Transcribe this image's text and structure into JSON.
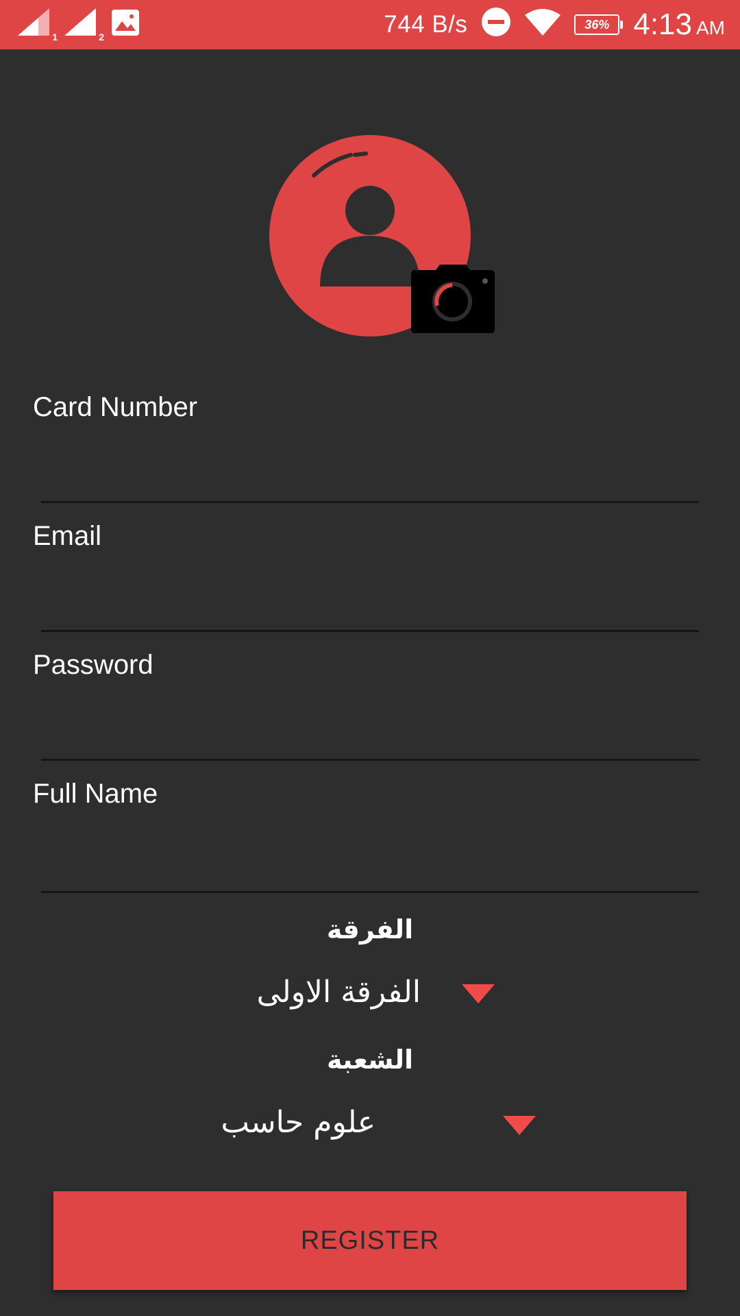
{
  "status_bar": {
    "sim1_label": "1",
    "sim2_label": "2",
    "network_speed": "744 B/s",
    "battery_percent": "36%",
    "time": "4:13",
    "ampm": "AM",
    "icons": [
      "signal-icon",
      "signal-icon",
      "gallery-icon",
      "do-not-disturb-icon",
      "wifi-icon",
      "battery-icon"
    ]
  },
  "colors": {
    "accent": "#e04545",
    "background": "#2e2e2e",
    "underline": "#151515",
    "arrow": "#f04a4a"
  },
  "avatar": {
    "icon": "user-avatar-icon",
    "camera_icon": "camera-icon"
  },
  "form": {
    "card_number": {
      "label": "Card Number",
      "value": "",
      "placeholder": ""
    },
    "email": {
      "label": "Email",
      "value": "",
      "placeholder": ""
    },
    "password": {
      "label": "Password",
      "value": "",
      "placeholder": ""
    },
    "full_name": {
      "label": "Full Name",
      "value": "",
      "placeholder": ""
    }
  },
  "level": {
    "title": "الفرقة",
    "selected": "الفرقة الاولى"
  },
  "department": {
    "title": "الشعبة",
    "selected": "علوم حاسب"
  },
  "register_button": "REGISTER"
}
